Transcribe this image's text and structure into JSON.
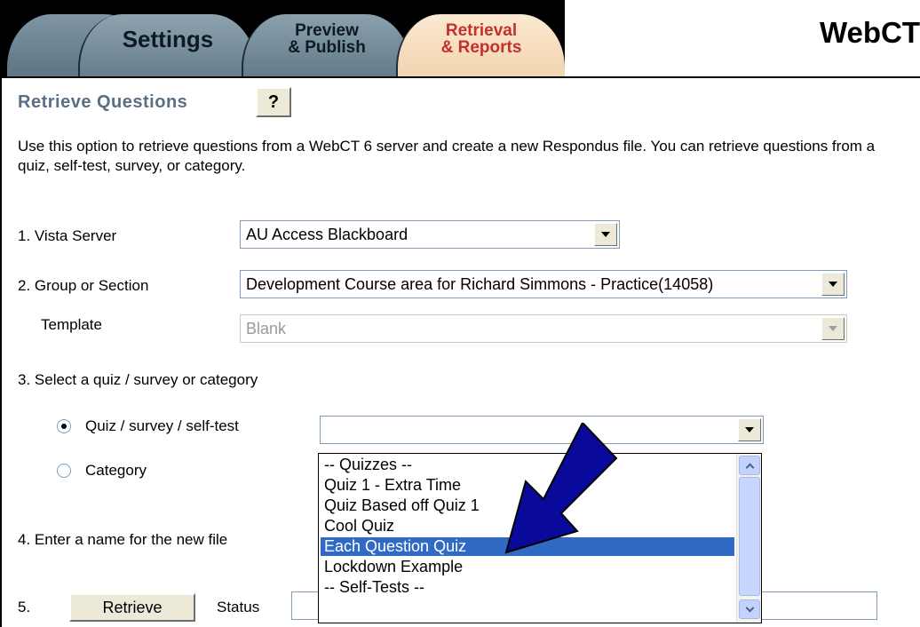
{
  "tabs": {
    "settings": "Settings",
    "preview_line1": "Preview",
    "preview_line2": "& Publish",
    "retrieval_line1": "Retrieval",
    "retrieval_line2": "& Reports"
  },
  "brand": "WebCT",
  "section": {
    "title": "Retrieve Questions",
    "help_label": "?"
  },
  "intro_text": "Use this option to retrieve questions from a WebCT 6 server and create a new Respondus file.  You can retrieve questions from a quiz, self-test, survey, or category.",
  "form": {
    "vista_server_label": "1. Vista Server",
    "vista_server_value": "AU Access Blackboard",
    "group_label": "2. Group or Section",
    "group_value": "Development Course area for Richard Simmons - Practice(14058)",
    "template_label": "Template",
    "template_value": "Blank",
    "select_label": "3. Select a quiz / survey or category",
    "radio_quiz_label": "Quiz / survey / self-test",
    "radio_category_label": "Category",
    "quiz_select_value": "",
    "name_label": "4. Enter a name for the new file",
    "step5_label": "5.",
    "retrieve_button": "Retrieve",
    "status_label": "Status"
  },
  "dropdown_items": [
    "-- Quizzes --",
    "Quiz 1 - Extra Time",
    "Quiz Based off Quiz 1",
    "Cool Quiz",
    "Each Question Quiz",
    "Lockdown Example",
    "-- Self-Tests --"
  ],
  "selected_index": 4,
  "colors": {
    "selection": "#316ac5",
    "arrow": "#0a0a9a",
    "title": "#5a6f85",
    "active_tab_text": "#c2312a"
  }
}
